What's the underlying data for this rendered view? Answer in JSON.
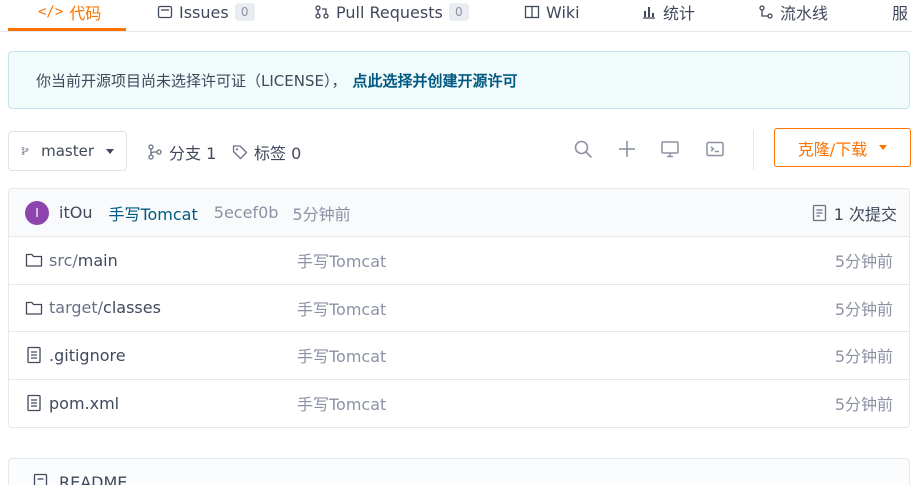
{
  "tabs": [
    {
      "label": "代码",
      "icon": "code-icon",
      "active": true
    },
    {
      "label": "Issues",
      "icon": "issues-icon",
      "count": "0"
    },
    {
      "label": "Pull Requests",
      "icon": "pull-request-icon",
      "count": "0"
    },
    {
      "label": "Wiki",
      "icon": "wiki-icon"
    },
    {
      "label": "统计",
      "icon": "stats-icon"
    },
    {
      "label": "流水线",
      "icon": "pipeline-icon"
    },
    {
      "label": "服",
      "icon": "service-icon"
    }
  ],
  "banner": {
    "text": "你当前开源项目尚未选择许可证（LICENSE），",
    "link": "点此选择并创建开源许可"
  },
  "toolbar": {
    "branch": "master",
    "branches_label": "分支 1",
    "tags_label": "标签 0",
    "clone_label": "克隆/下载"
  },
  "commit": {
    "avatar_letter": "I",
    "author": "itOu",
    "message": "手写Tomcat",
    "sha": "5ecef0b",
    "time": "5分钟前",
    "count_label": "1 次提交"
  },
  "files": [
    {
      "type": "folder",
      "dir": "src/",
      "name": "main",
      "message": "手写Tomcat",
      "time": "5分钟前"
    },
    {
      "type": "folder",
      "dir": "target/",
      "name": "classes",
      "message": "手写Tomcat",
      "time": "5分钟前"
    },
    {
      "type": "file",
      "dir": "",
      "name": ".gitignore",
      "message": "手写Tomcat",
      "time": "5分钟前"
    },
    {
      "type": "file",
      "dir": "",
      "name": "pom.xml",
      "message": "手写Tomcat",
      "time": "5分钟前"
    }
  ],
  "readme": {
    "label": "README"
  },
  "colors": {
    "accent": "#fe7300",
    "link": "#005980",
    "avatar": "#8e44ad"
  }
}
